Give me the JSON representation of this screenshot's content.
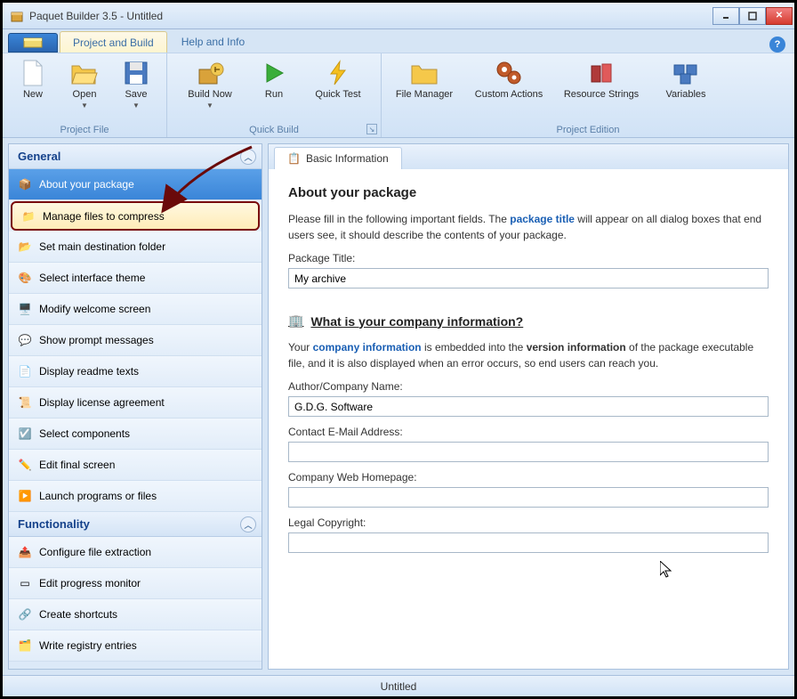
{
  "window": {
    "title": "Paquet Builder 3.5 - Untitled"
  },
  "tabs": {
    "project_build": "Project and Build",
    "help": "Help and Info"
  },
  "ribbon": {
    "new": "New",
    "open": "Open",
    "save": "Save",
    "build_now": "Build Now",
    "run": "Run",
    "quick_test": "Quick Test",
    "file_manager": "File Manager",
    "custom_actions": "Custom Actions",
    "resource_strings": "Resource Strings",
    "variables": "Variables",
    "group_project_file": "Project File",
    "group_quick_build": "Quick Build",
    "group_project_edition": "Project Edition"
  },
  "nav": {
    "general_header": "General",
    "functionality_header": "Functionality",
    "general": [
      "About your package",
      "Manage files to compress",
      "Set main destination folder",
      "Select interface theme",
      "Modify welcome screen",
      "Show prompt messages",
      "Display readme texts",
      "Display license agreement",
      "Select components",
      "Edit final screen",
      "Launch programs or files"
    ],
    "functionality": [
      "Configure file extraction",
      "Edit progress monitor",
      "Create shortcuts",
      "Write registry entries"
    ]
  },
  "content": {
    "tab_label": "Basic Information",
    "heading": "About your package",
    "intro_before": "Please fill in the following important fields. The ",
    "intro_link": "package title",
    "intro_after": " will appear on all dialog boxes that end users see, it should describe the contents of your package.",
    "package_title_label": "Package Title:",
    "package_title_value": "My archive",
    "company_section": "What is your company information?",
    "company_intro_before": "Your ",
    "company_intro_link": "company information",
    "company_intro_mid": " is embedded into the ",
    "company_intro_bold": "version information",
    "company_intro_after": " of the package executable file, and it is also displayed when an error occurs, so end users can reach you.",
    "author_label": "Author/Company Name:",
    "author_value": "G.D.G. Software",
    "email_label": "Contact E-Mail Address:",
    "email_value": "",
    "homepage_label": "Company Web Homepage:",
    "homepage_value": "",
    "copyright_label": "Legal Copyright:",
    "copyright_value": ""
  },
  "status": {
    "text": "Untitled"
  }
}
